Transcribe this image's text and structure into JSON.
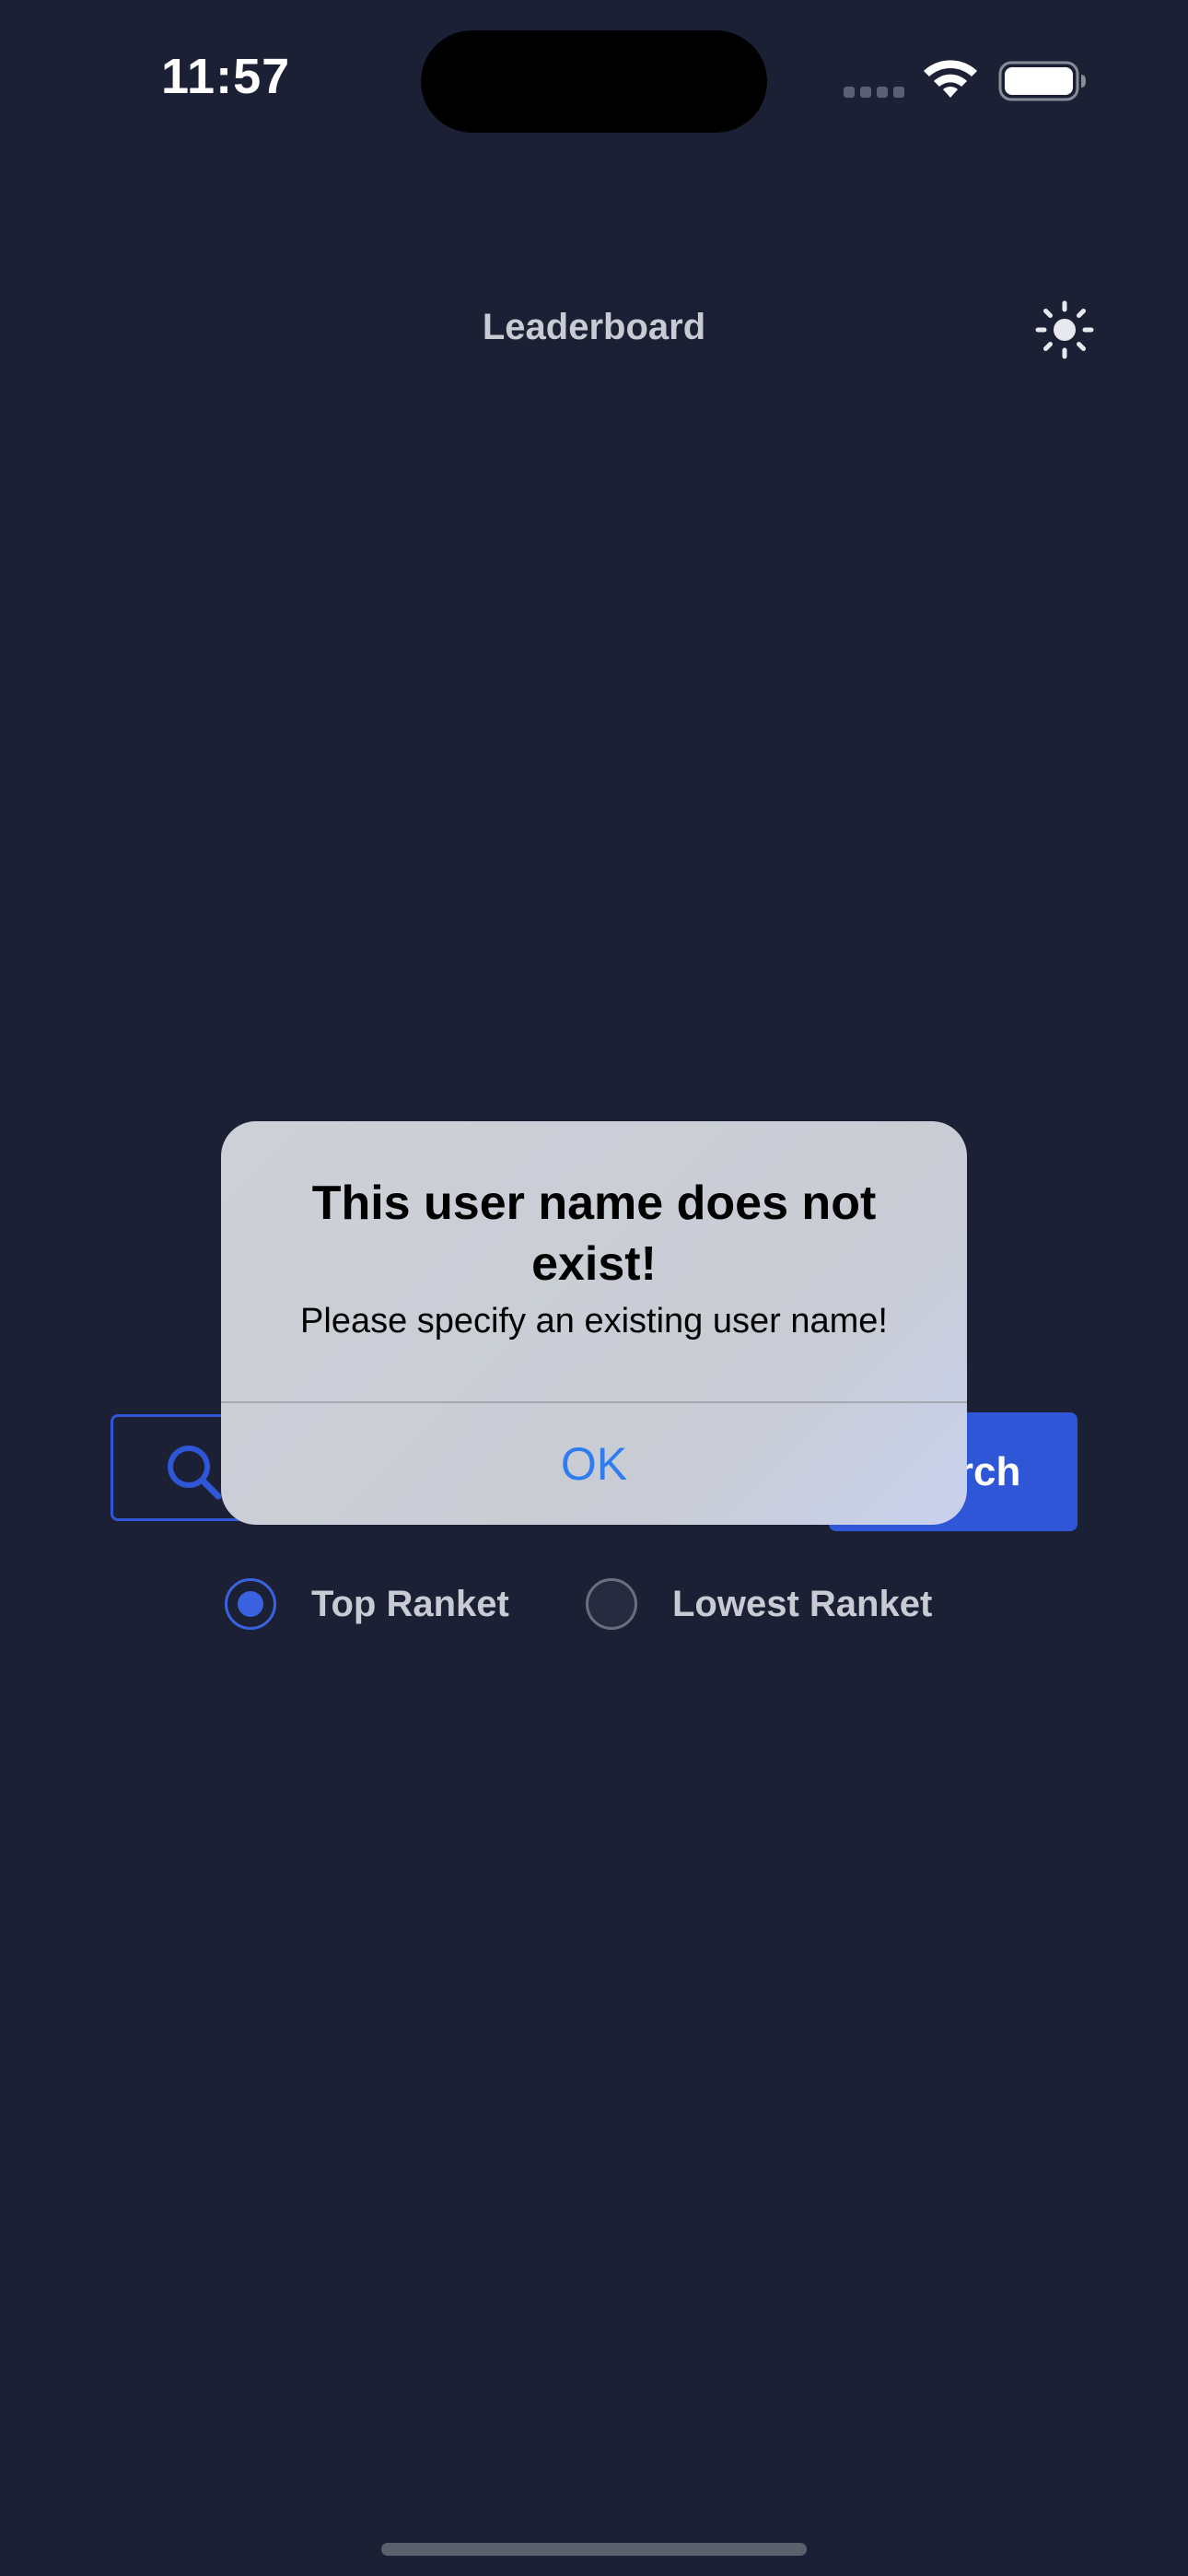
{
  "status_bar": {
    "time": "11:57",
    "icons": [
      "cellular-signal-icon",
      "wifi-icon",
      "battery-icon"
    ]
  },
  "header": {
    "title": "Leaderboard",
    "theme_icon": "sun-icon"
  },
  "search": {
    "icon": "search-icon",
    "button_label": "Search"
  },
  "ranking_options": [
    {
      "label": "Top Ranket",
      "selected": true
    },
    {
      "label": "Lowest Ranket",
      "selected": false
    }
  ],
  "alert": {
    "title": "This user name does not exist!",
    "message": "Please specify an existing user name!",
    "ok_label": "OK"
  },
  "colors": {
    "background": "#1c2035",
    "accent": "#2e56d6",
    "alert_button": "#2f7cf0"
  }
}
